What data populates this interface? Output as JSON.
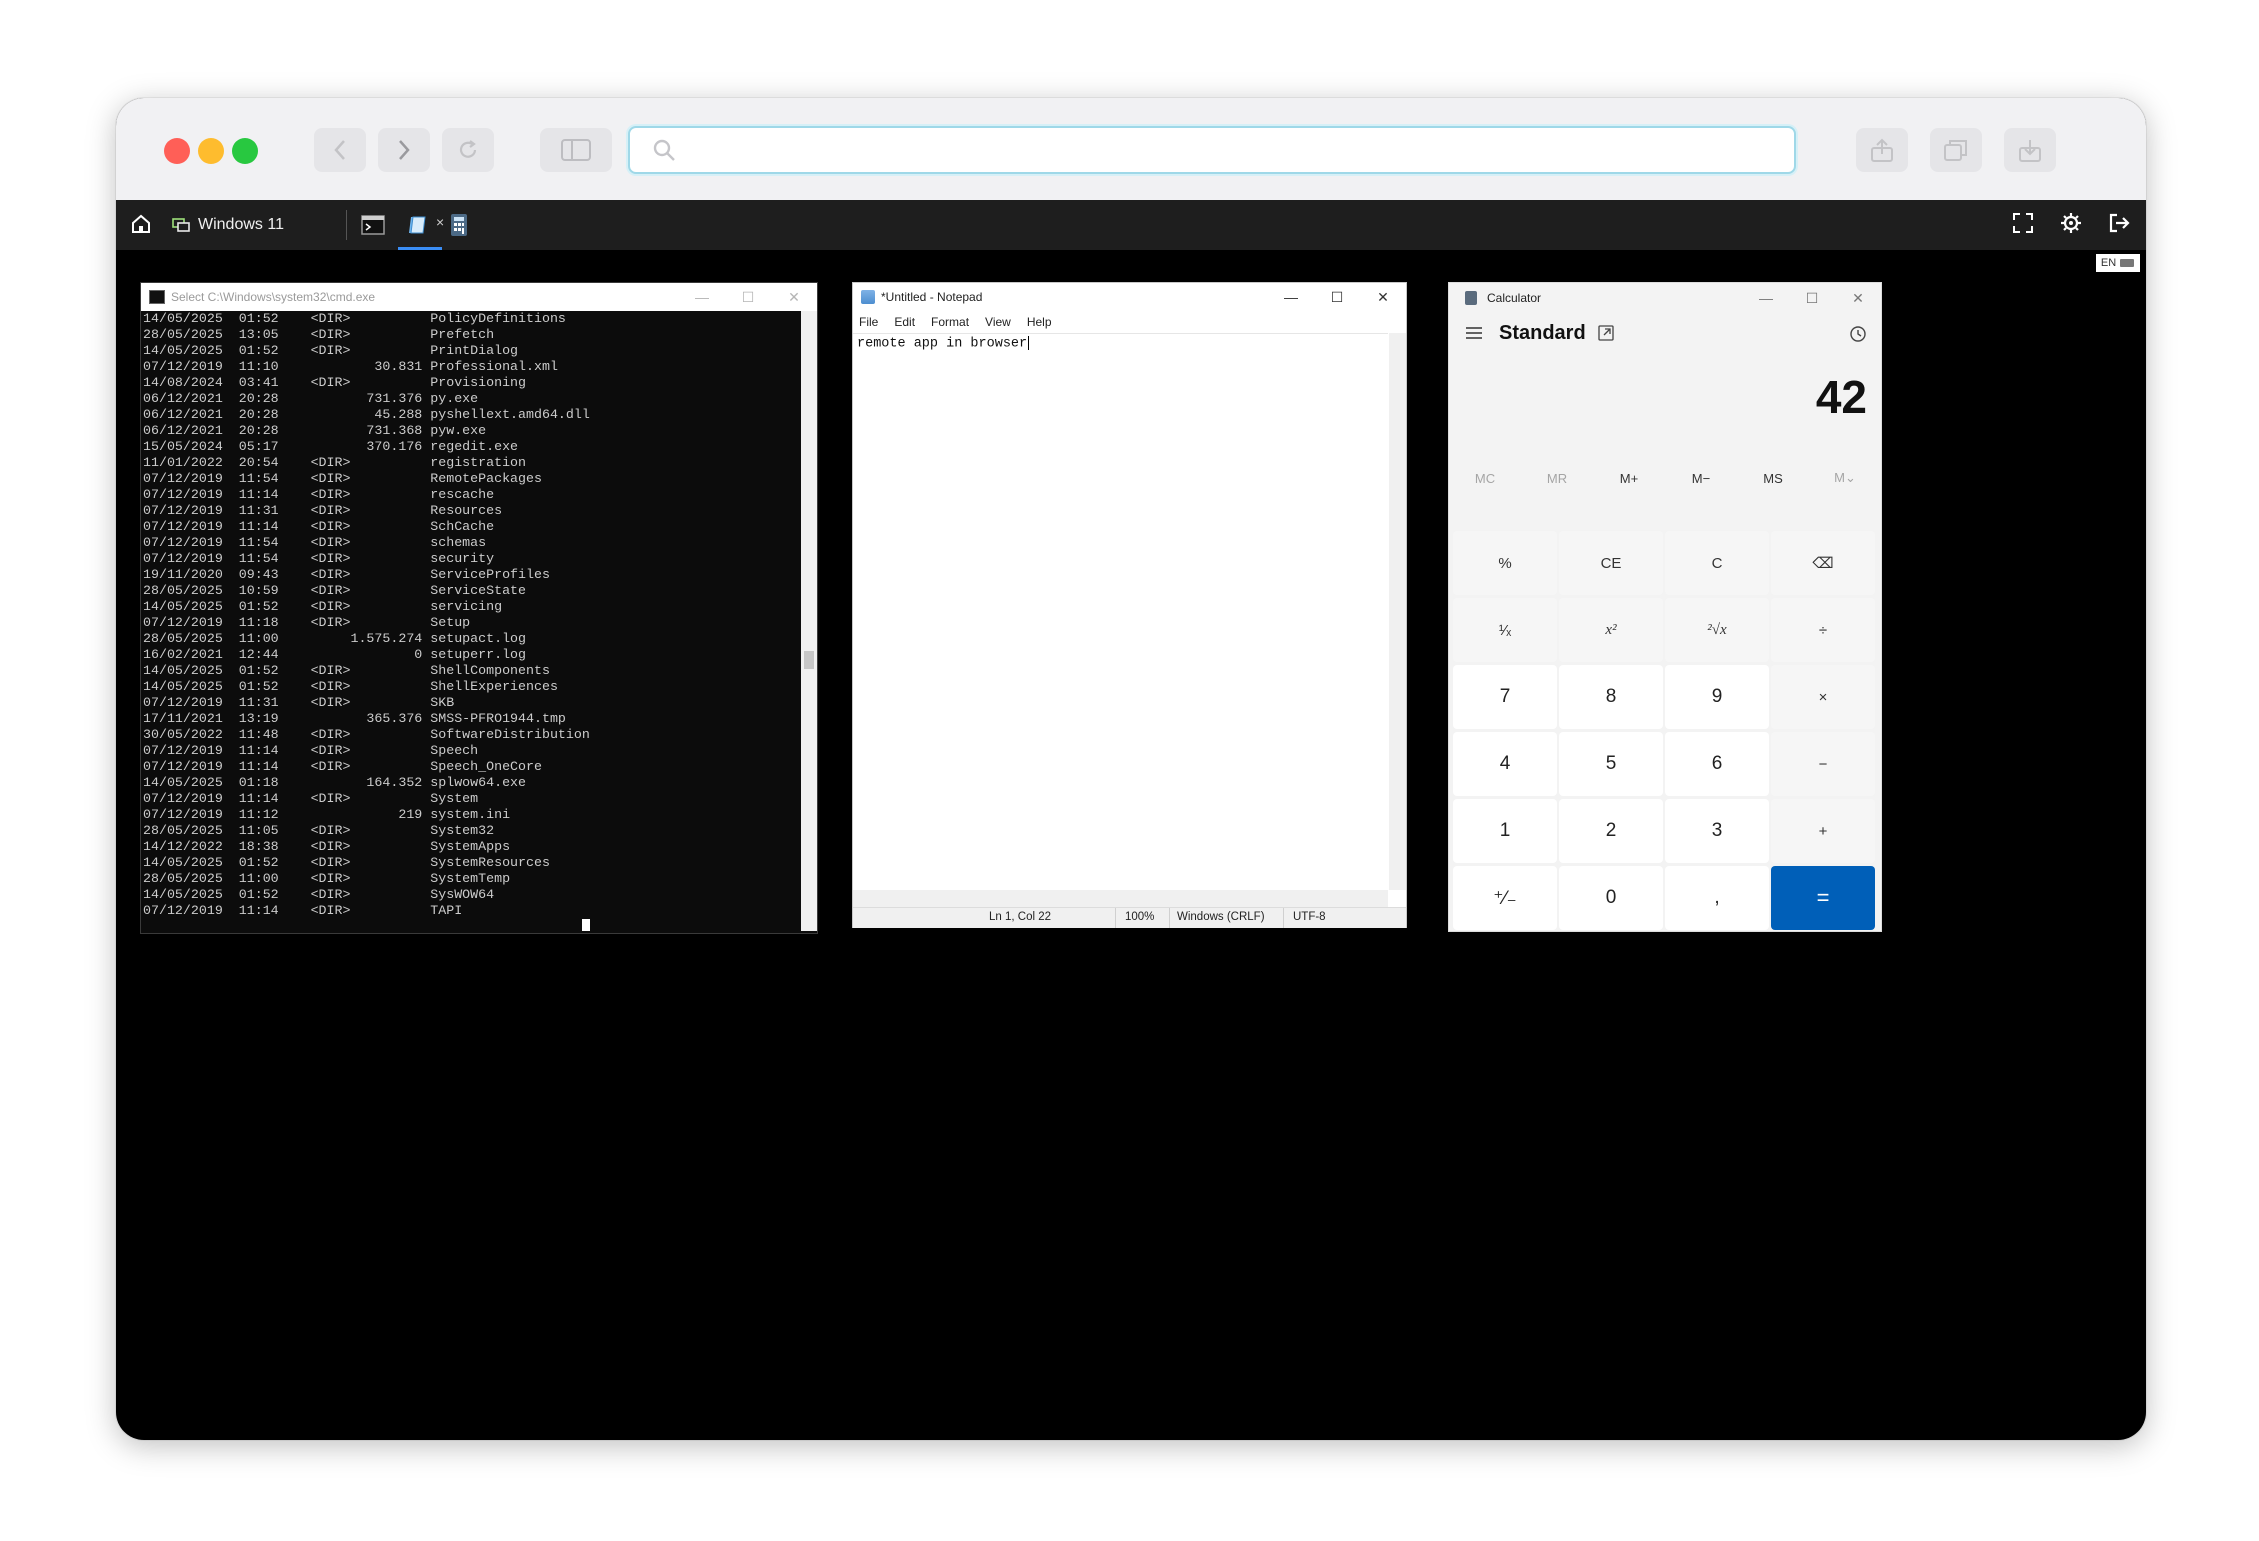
{
  "browser": {
    "url_value": "",
    "url_placeholder": ""
  },
  "remote_bar": {
    "tab_title": "Windows 11",
    "tab_close": "×",
    "language": "EN"
  },
  "cmd": {
    "title": "Select C:\\Windows\\system32\\cmd.exe",
    "lines": [
      "14/05/2025  01:52    <DIR>          PolicyDefinitions",
      "28/05/2025  13:05    <DIR>          Prefetch",
      "14/05/2025  01:52    <DIR>          PrintDialog",
      "07/12/2019  11:10            30.831 Professional.xml",
      "14/08/2024  03:41    <DIR>          Provisioning",
      "06/12/2021  20:28           731.376 py.exe",
      "06/12/2021  20:28            45.288 pyshellext.amd64.dll",
      "06/12/2021  20:28           731.368 pyw.exe",
      "15/05/2024  05:17           370.176 regedit.exe",
      "11/01/2022  20:54    <DIR>          registration",
      "07/12/2019  11:54    <DIR>          RemotePackages",
      "07/12/2019  11:14    <DIR>          rescache",
      "07/12/2019  11:31    <DIR>          Resources",
      "07/12/2019  11:14    <DIR>          SchCache",
      "07/12/2019  11:54    <DIR>          schemas",
      "07/12/2019  11:54    <DIR>          security",
      "19/11/2020  09:43    <DIR>          ServiceProfiles",
      "28/05/2025  10:59    <DIR>          ServiceState",
      "14/05/2025  01:52    <DIR>          servicing",
      "07/12/2019  11:18    <DIR>          Setup",
      "28/05/2025  11:00         1.575.274 setupact.log",
      "16/02/2021  12:44                 0 setuperr.log",
      "14/05/2025  01:52    <DIR>          ShellComponents",
      "14/05/2025  01:52    <DIR>          ShellExperiences",
      "07/12/2019  11:31    <DIR>          SKB",
      "17/11/2021  13:19           365.376 SMSS-PFRO1944.tmp",
      "30/05/2022  11:48    <DIR>          SoftwareDistribution",
      "07/12/2019  11:14    <DIR>          Speech",
      "07/12/2019  11:14    <DIR>          Speech_OneCore",
      "14/05/2025  01:18           164.352 splwow64.exe",
      "07/12/2019  11:14    <DIR>          System",
      "07/12/2019  11:12               219 system.ini",
      "28/05/2025  11:05    <DIR>          System32",
      "14/12/2022  18:38    <DIR>          SystemApps",
      "14/05/2025  01:52    <DIR>          SystemResources",
      "28/05/2025  11:00    <DIR>          SystemTemp",
      "14/05/2025  01:52    <DIR>          SysWOW64",
      "07/12/2019  11:14    <DIR>          TAPI"
    ]
  },
  "notepad": {
    "title": "*Untitled - Notepad",
    "menu": [
      "File",
      "Edit",
      "Format",
      "View",
      "Help"
    ],
    "text": "remote app in browser",
    "status": {
      "position": "Ln 1, Col 22",
      "zoom": "100%",
      "line_ending": "Windows (CRLF)",
      "encoding": "UTF-8"
    }
  },
  "calculator": {
    "title": "Calculator",
    "mode": "Standard",
    "display": "42",
    "memory": [
      "MC",
      "MR",
      "M+",
      "M−",
      "MS",
      "M⌄"
    ],
    "keys": [
      "%",
      "CE",
      "C",
      "⌫",
      "¹⁄ₓ",
      "x²",
      "²√x",
      "÷",
      "7",
      "8",
      "9",
      "×",
      "4",
      "5",
      "6",
      "−",
      "1",
      "2",
      "3",
      "+",
      "⁺⁄₋",
      "0",
      ",",
      "="
    ]
  },
  "colors": {
    "accent_equals": "#005fb8",
    "url_focus": "#9fd8e8",
    "remote_bar": "#1e1e1e",
    "active_tab_indicator": "#3a8df5"
  }
}
